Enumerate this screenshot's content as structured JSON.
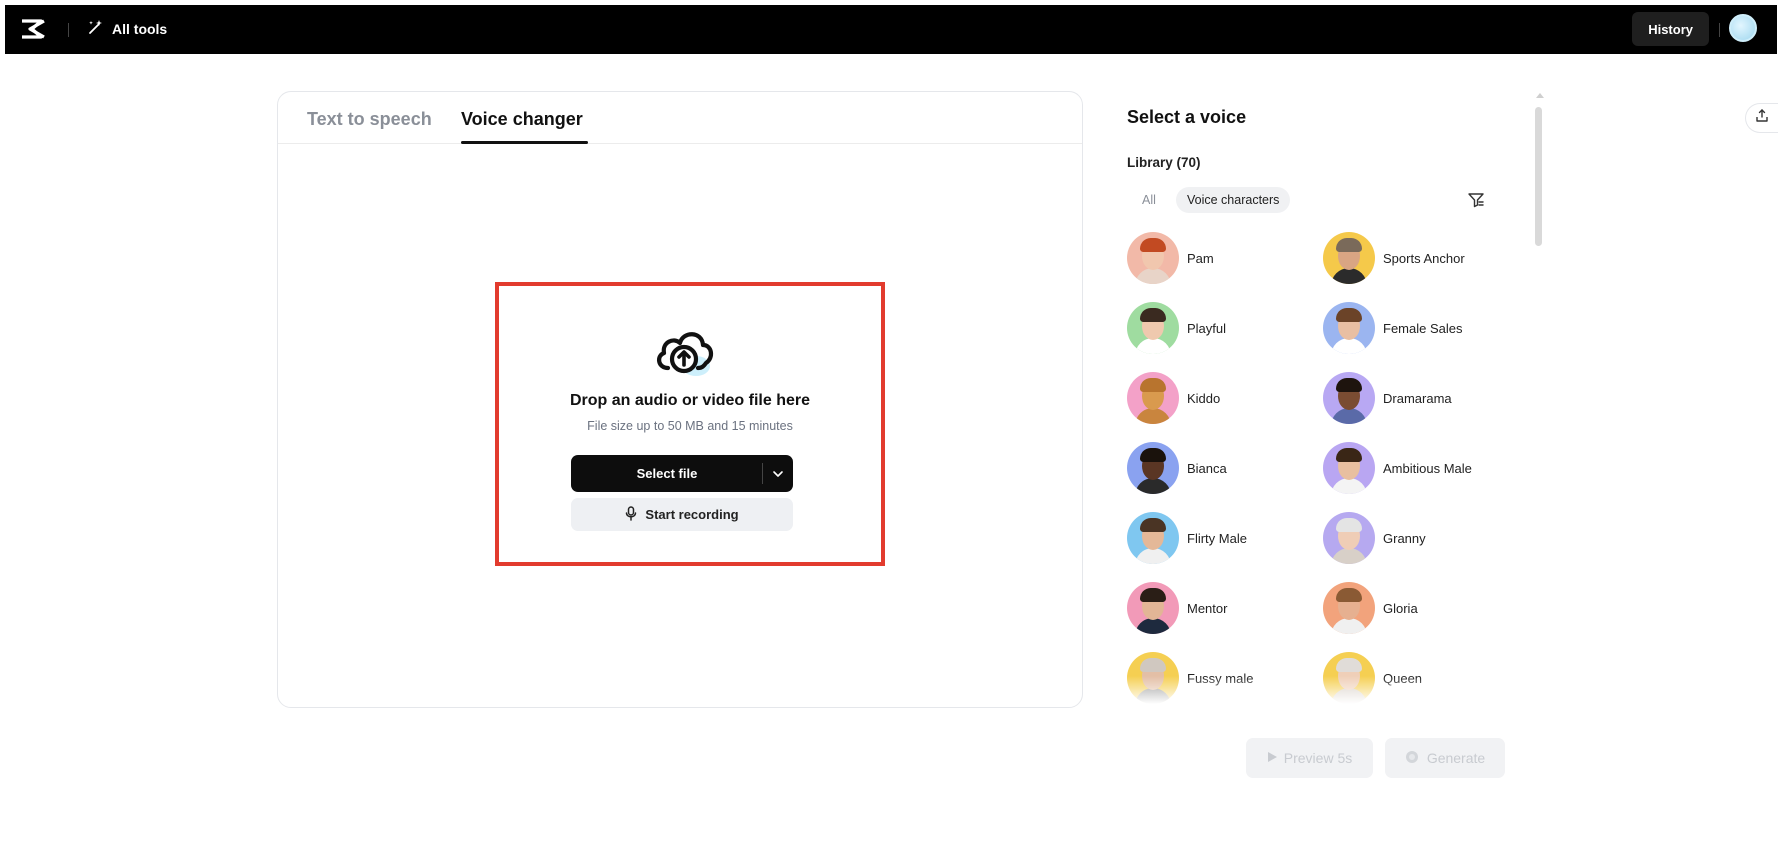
{
  "topbar": {
    "logo_icon": "capcut-logo-icon",
    "all_tools_label": "All tools",
    "all_tools_icon": "magic-wand-icon",
    "history_label": "History"
  },
  "tabs": [
    {
      "label": "Text to speech",
      "active": false
    },
    {
      "label": "Voice changer",
      "active": true
    }
  ],
  "dropzone": {
    "icon": "cloud-upload-icon",
    "title": "Drop an audio or video file here",
    "subtitle": "File size up to 50 MB and 15 minutes",
    "select_file_label": "Select file",
    "start_recording_label": "Start recording",
    "highlight_color": "#e23b2e"
  },
  "voice_panel": {
    "title": "Select a voice",
    "library_label": "Library (70)",
    "filters": [
      {
        "label": "All",
        "active": false
      },
      {
        "label": "Voice characters",
        "active": true
      }
    ],
    "voices": [
      {
        "name": "Pam",
        "bg": "#f2b9a8",
        "skin": "#f1c7ae",
        "hair": "#c24a22",
        "shirt": "#e8d4c8"
      },
      {
        "name": "Sports Anchor",
        "bg": "#f5c94a",
        "skin": "#d9a583",
        "hair": "#7a6a5a",
        "shirt": "#2b2b2b"
      },
      {
        "name": "Playful",
        "bg": "#9fdca0",
        "skin": "#efc9ae",
        "hair": "#3a2a20",
        "shirt": "#ffffff"
      },
      {
        "name": "Female Sales",
        "bg": "#9bb5f0",
        "skin": "#e9bfa3",
        "hair": "#6b4328",
        "shirt": "#ffffff"
      },
      {
        "name": "Kiddo",
        "bg": "#f3a1c8",
        "skin": "#d99a4e",
        "hair": "#b8742e",
        "shirt": "#c9853e"
      },
      {
        "name": "Dramarama",
        "bg": "#b8a8f3",
        "skin": "#7a4c32",
        "hair": "#1e140e",
        "shirt": "#5a6aa8"
      },
      {
        "name": "Bianca",
        "bg": "#8aa2f0",
        "skin": "#5a3624",
        "hair": "#1a120c",
        "shirt": "#2a2a2a"
      },
      {
        "name": "Ambitious Male",
        "bg": "#b9a6f2",
        "skin": "#e8bfa0",
        "hair": "#3a2616",
        "shirt": "#f4f4f4"
      },
      {
        "name": "Flirty Male",
        "bg": "#7fc7f0",
        "skin": "#e4b898",
        "hair": "#4a3424",
        "shirt": "#f0f0f0"
      },
      {
        "name": "Granny",
        "bg": "#b6a9f0",
        "skin": "#efcdb6",
        "hair": "#e4e4e4",
        "shirt": "#d8d0c8"
      },
      {
        "name": "Mentor",
        "bg": "#f29ab8",
        "skin": "#e2b596",
        "hair": "#2a1e16",
        "shirt": "#1e2a3e"
      },
      {
        "name": "Gloria",
        "bg": "#f2a37c",
        "skin": "#e6b090",
        "hair": "#8a5a34",
        "shirt": "#f0f0f0"
      },
      {
        "name": "Fussy male",
        "bg": "#f5cf52",
        "skin": "#e3bfa6",
        "hair": "#d0c8c0",
        "shirt": "#9a9a9a"
      },
      {
        "name": "Queen",
        "bg": "#f5cf52",
        "skin": "#efcfb8",
        "hair": "#e0dcd8",
        "shirt": "#d8d0c8"
      }
    ]
  },
  "actions": {
    "preview_label": "Preview 5s",
    "generate_label": "Generate"
  }
}
